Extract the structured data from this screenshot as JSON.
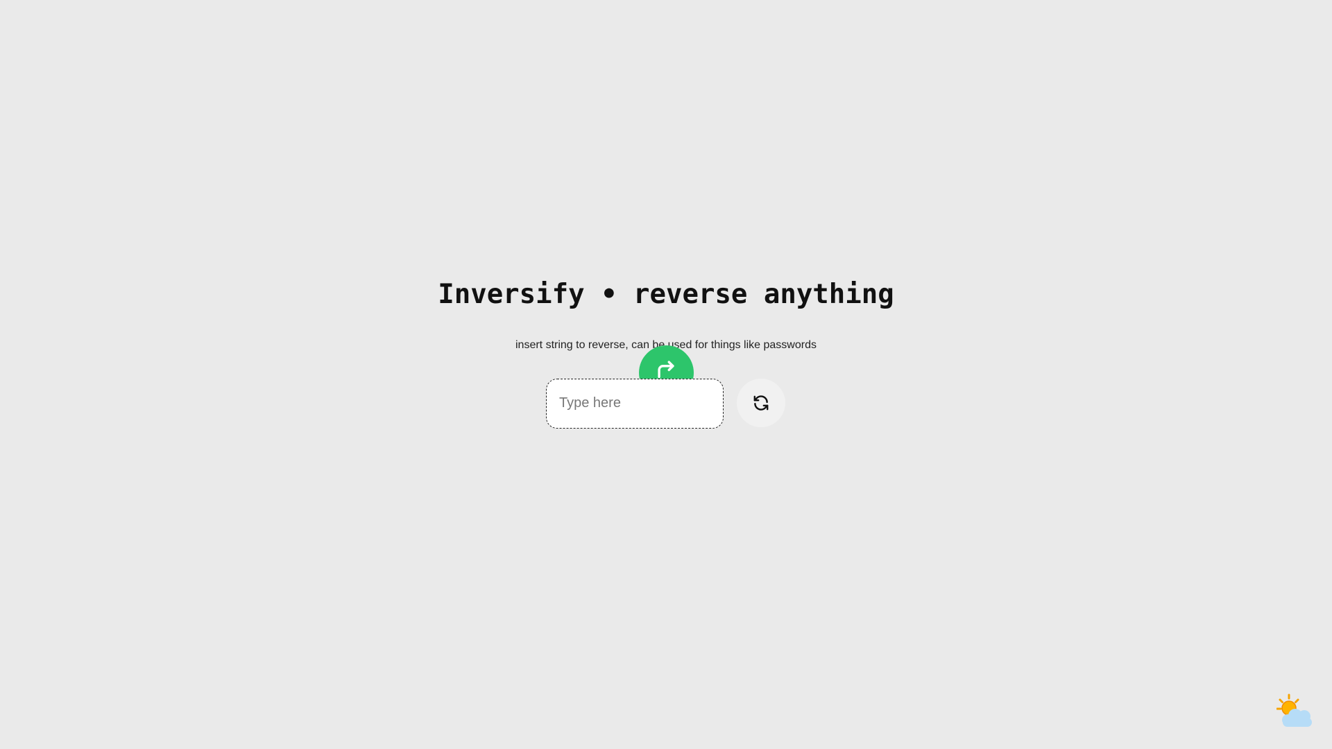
{
  "header": {
    "title": "Inversify • reverse anything",
    "subtitle": "insert string to reverse, can be used for things like passwords"
  },
  "input": {
    "placeholder": "Type here",
    "value": ""
  },
  "buttons": {
    "reverse_icon": "redo-arrow-icon",
    "refresh_icon": "refresh-icon",
    "theme_icon": "sun-behind-cloud-icon"
  },
  "colors": {
    "background": "#eaeaea",
    "accent": "#2dc56b",
    "input_background": "#ffffff",
    "refresh_background": "#f1f1f1"
  }
}
